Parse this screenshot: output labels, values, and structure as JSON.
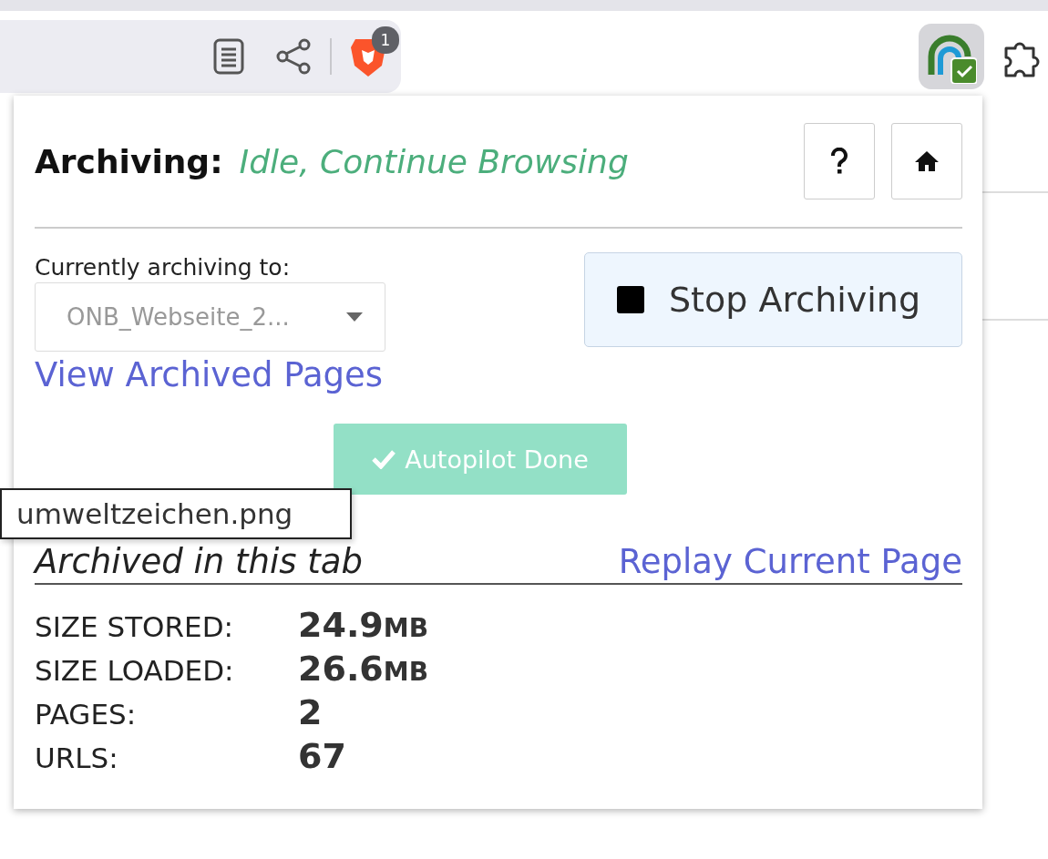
{
  "browser": {
    "brave_badge": "1"
  },
  "popup": {
    "title": "Archiving:",
    "status": "Idle, Continue Browsing",
    "archive_label": "Currently archiving to:",
    "archive_select": "ONB_Webseite_2...",
    "stop_button": "Stop Archiving",
    "view_link": "View Archived Pages",
    "autopilot_button": "Autopilot Done",
    "tooltip": "umweltzeichen.png",
    "section_title": "Archived in this tab",
    "replay_link": "Replay Current Page",
    "stats": [
      {
        "label": "SIZE STORED:",
        "value": "24.9",
        "unit": "MB"
      },
      {
        "label": "SIZE LOADED:",
        "value": "26.6",
        "unit": "MB"
      },
      {
        "label": "PAGES:",
        "value": "2"
      },
      {
        "label": "URLS:",
        "value": "67"
      }
    ]
  }
}
